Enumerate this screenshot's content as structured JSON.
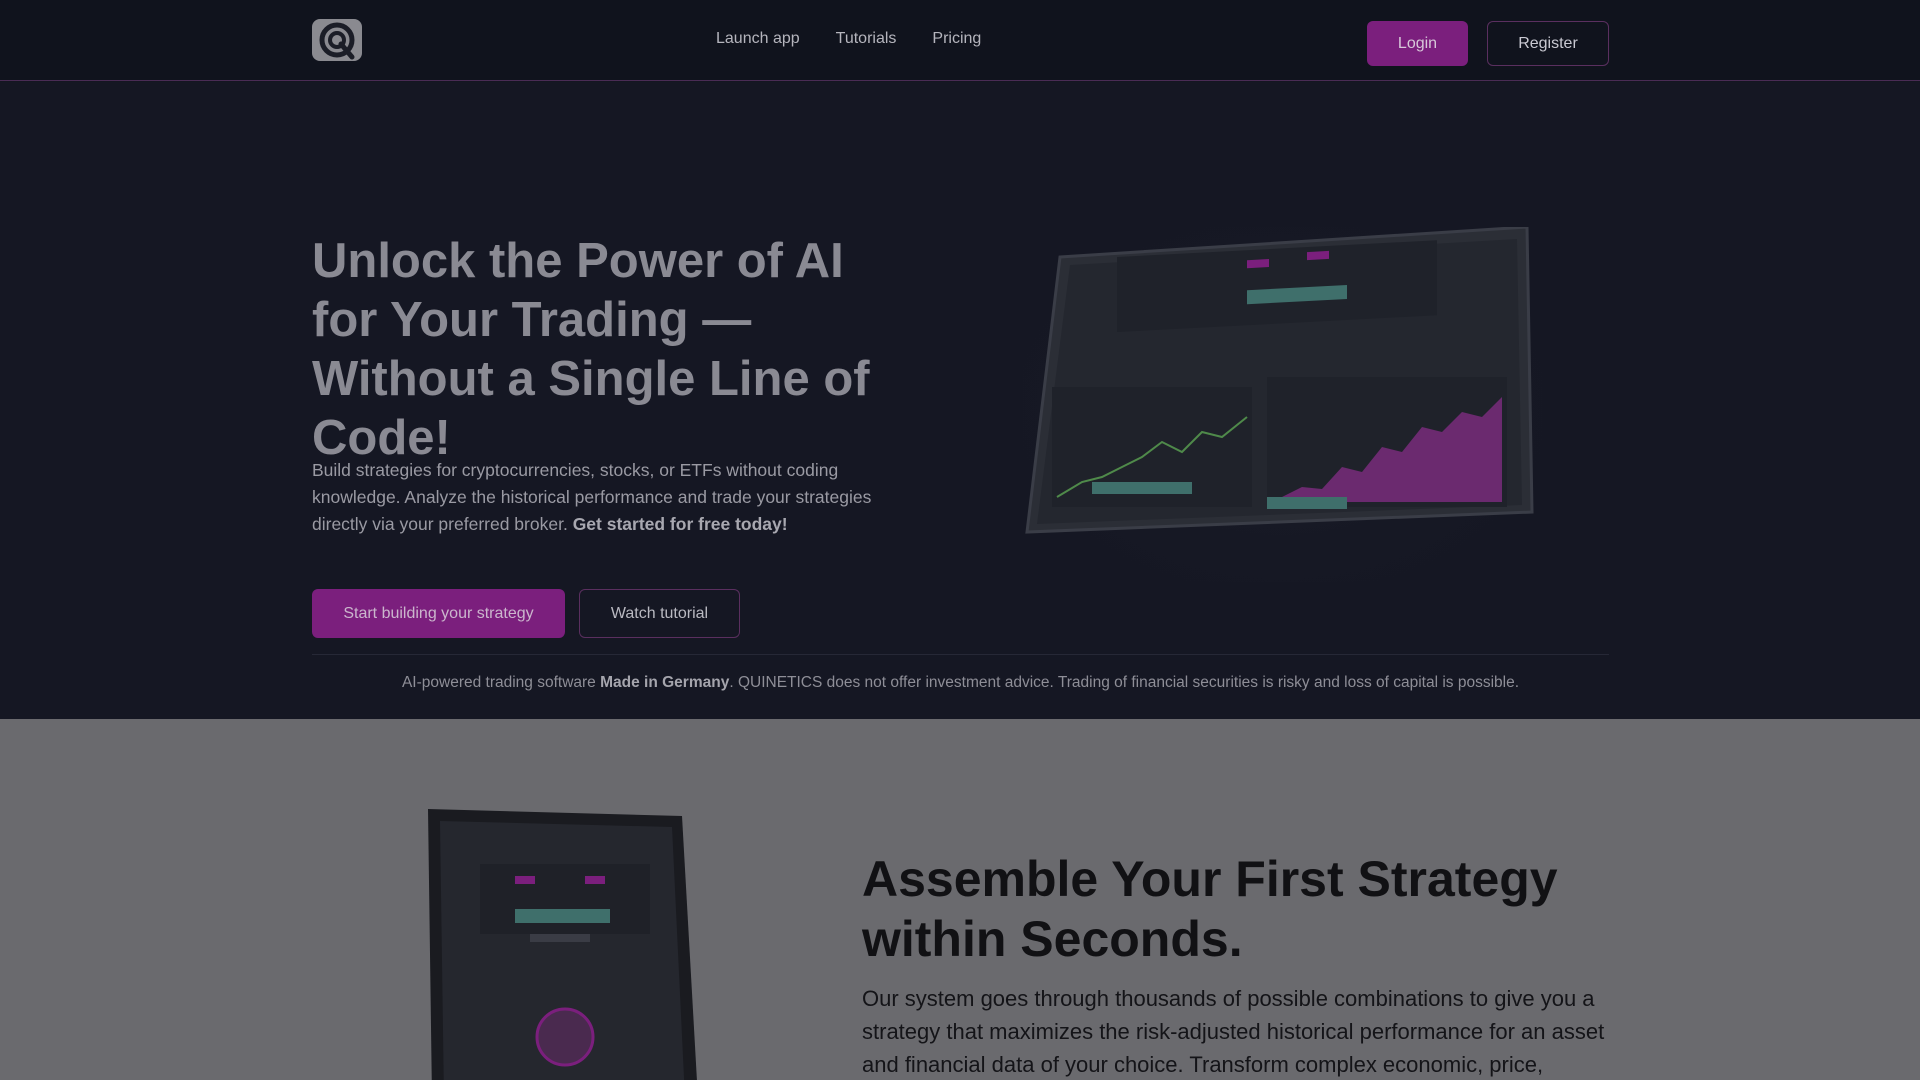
{
  "nav": {
    "links": [
      "Launch app",
      "Tutorials",
      "Pricing"
    ],
    "login_label": "Login",
    "register_label": "Register"
  },
  "hero": {
    "title": "Unlock the Power of AI for Your Trading — Without a Single Line of Code!",
    "description": "Build strategies for cryptocurrencies, stocks, or ETFs without coding knowledge. Analyze the historical performance and trade your strategies directly via your preferred broker.",
    "description_bold": "Get started for free today!",
    "start_label": "Start building your strategy",
    "watch_label": "Watch tutorial"
  },
  "disclaimer": {
    "prefix": "AI-powered trading software ",
    "bold": "Made in Germany",
    "suffix": ". QUINETICS does not offer investment advice. Trading of financial securities is risky and loss of capital is possible."
  },
  "section2": {
    "title": "Assemble Your First Strategy within Seconds.",
    "text": "Our system goes through thousands of possible combinations to give you a strategy that maximizes the risk-adjusted historical performance for an asset and financial data of your choice. Transform complex economic, price,"
  },
  "colors": {
    "accent": "#7b1f7d",
    "background": "#151723",
    "section2_bg": "#6a6a6e"
  }
}
